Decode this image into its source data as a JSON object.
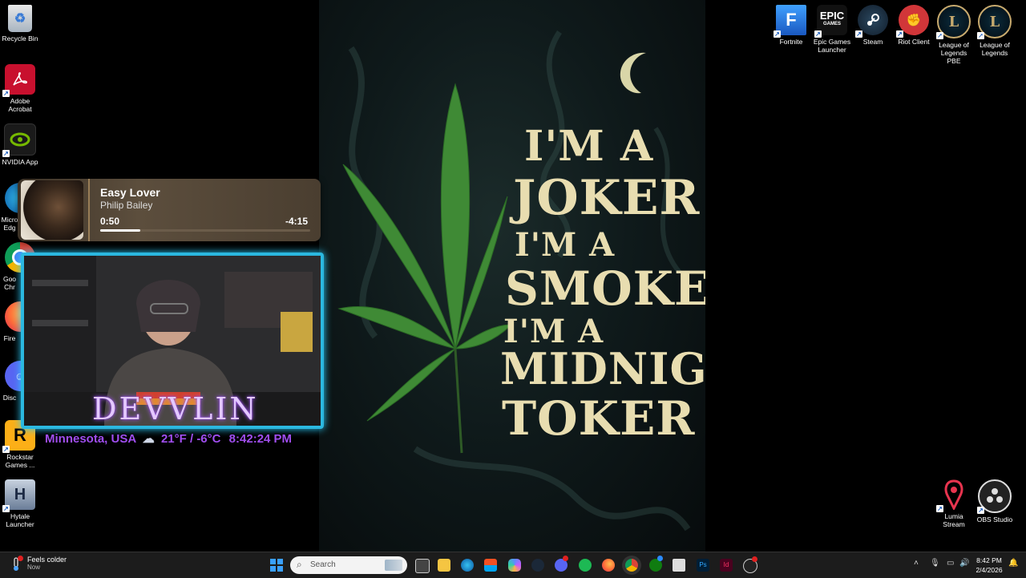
{
  "desktop_icons_left": [
    {
      "name": "recycle-bin",
      "label": "Recycle Bin"
    },
    {
      "name": "adobe-acrobat",
      "label": "Adobe Acrobat"
    },
    {
      "name": "nvidia-app",
      "label": "NVIDIA App"
    },
    {
      "name": "microsoft-edge",
      "label": "Micro Edg"
    },
    {
      "name": "google-chrome",
      "label": "Goo Chr"
    },
    {
      "name": "firefox",
      "label": "Fire"
    },
    {
      "name": "discord",
      "label": "Disc"
    },
    {
      "name": "rockstar-games",
      "label": "Rockstar Games ..."
    },
    {
      "name": "hytale-launcher",
      "label": "Hytale Launcher"
    }
  ],
  "desktop_icons_right": [
    {
      "name": "fortnite",
      "label": "Fortnite"
    },
    {
      "name": "epic-games-launcher",
      "label": "Epic Games Launcher"
    },
    {
      "name": "steam",
      "label": "Steam"
    },
    {
      "name": "riot-client",
      "label": "Riot Client"
    },
    {
      "name": "league-of-legends-pbe",
      "label": "League of Legends PBE"
    },
    {
      "name": "league-of-legends",
      "label": "League of Legends"
    },
    {
      "name": "lumia-stream",
      "label": "Lumia Stream"
    },
    {
      "name": "obs-studio",
      "label": "OBS Studio"
    }
  ],
  "wallpaper": {
    "line1": "I'M A",
    "line2": "JOKER",
    "line3": "I'M A",
    "line4": "SMOKER",
    "line5": "I'M A",
    "line6": "MIDNIGHT",
    "line7": "TOKER",
    "epic_logo_text": "EPIC",
    "epic_logo_sub": "GAMES"
  },
  "media": {
    "title": "Easy Lover",
    "artist": "Philip Bailey",
    "current": "0:50",
    "remaining": "-4:15",
    "progress": 0.19
  },
  "stream_overlay": {
    "name": "DEVVLIN",
    "location": "Minnesota, USA",
    "weather_icon": "☁",
    "temperature": "21°F / -6°C",
    "time": "8:42:24 PM"
  },
  "taskbar": {
    "weather_title": "Feels colder",
    "weather_sub": "Now",
    "search_placeholder": "Search",
    "clock_time": "8:42 PM",
    "clock_date": "2/4/2026"
  },
  "colors": {
    "overlay_border": "#2bb8e0",
    "overlay_name": "#e4c8ff",
    "overlay_info": "#a04ef0",
    "wallpaper_text": "#e8ddb0"
  }
}
